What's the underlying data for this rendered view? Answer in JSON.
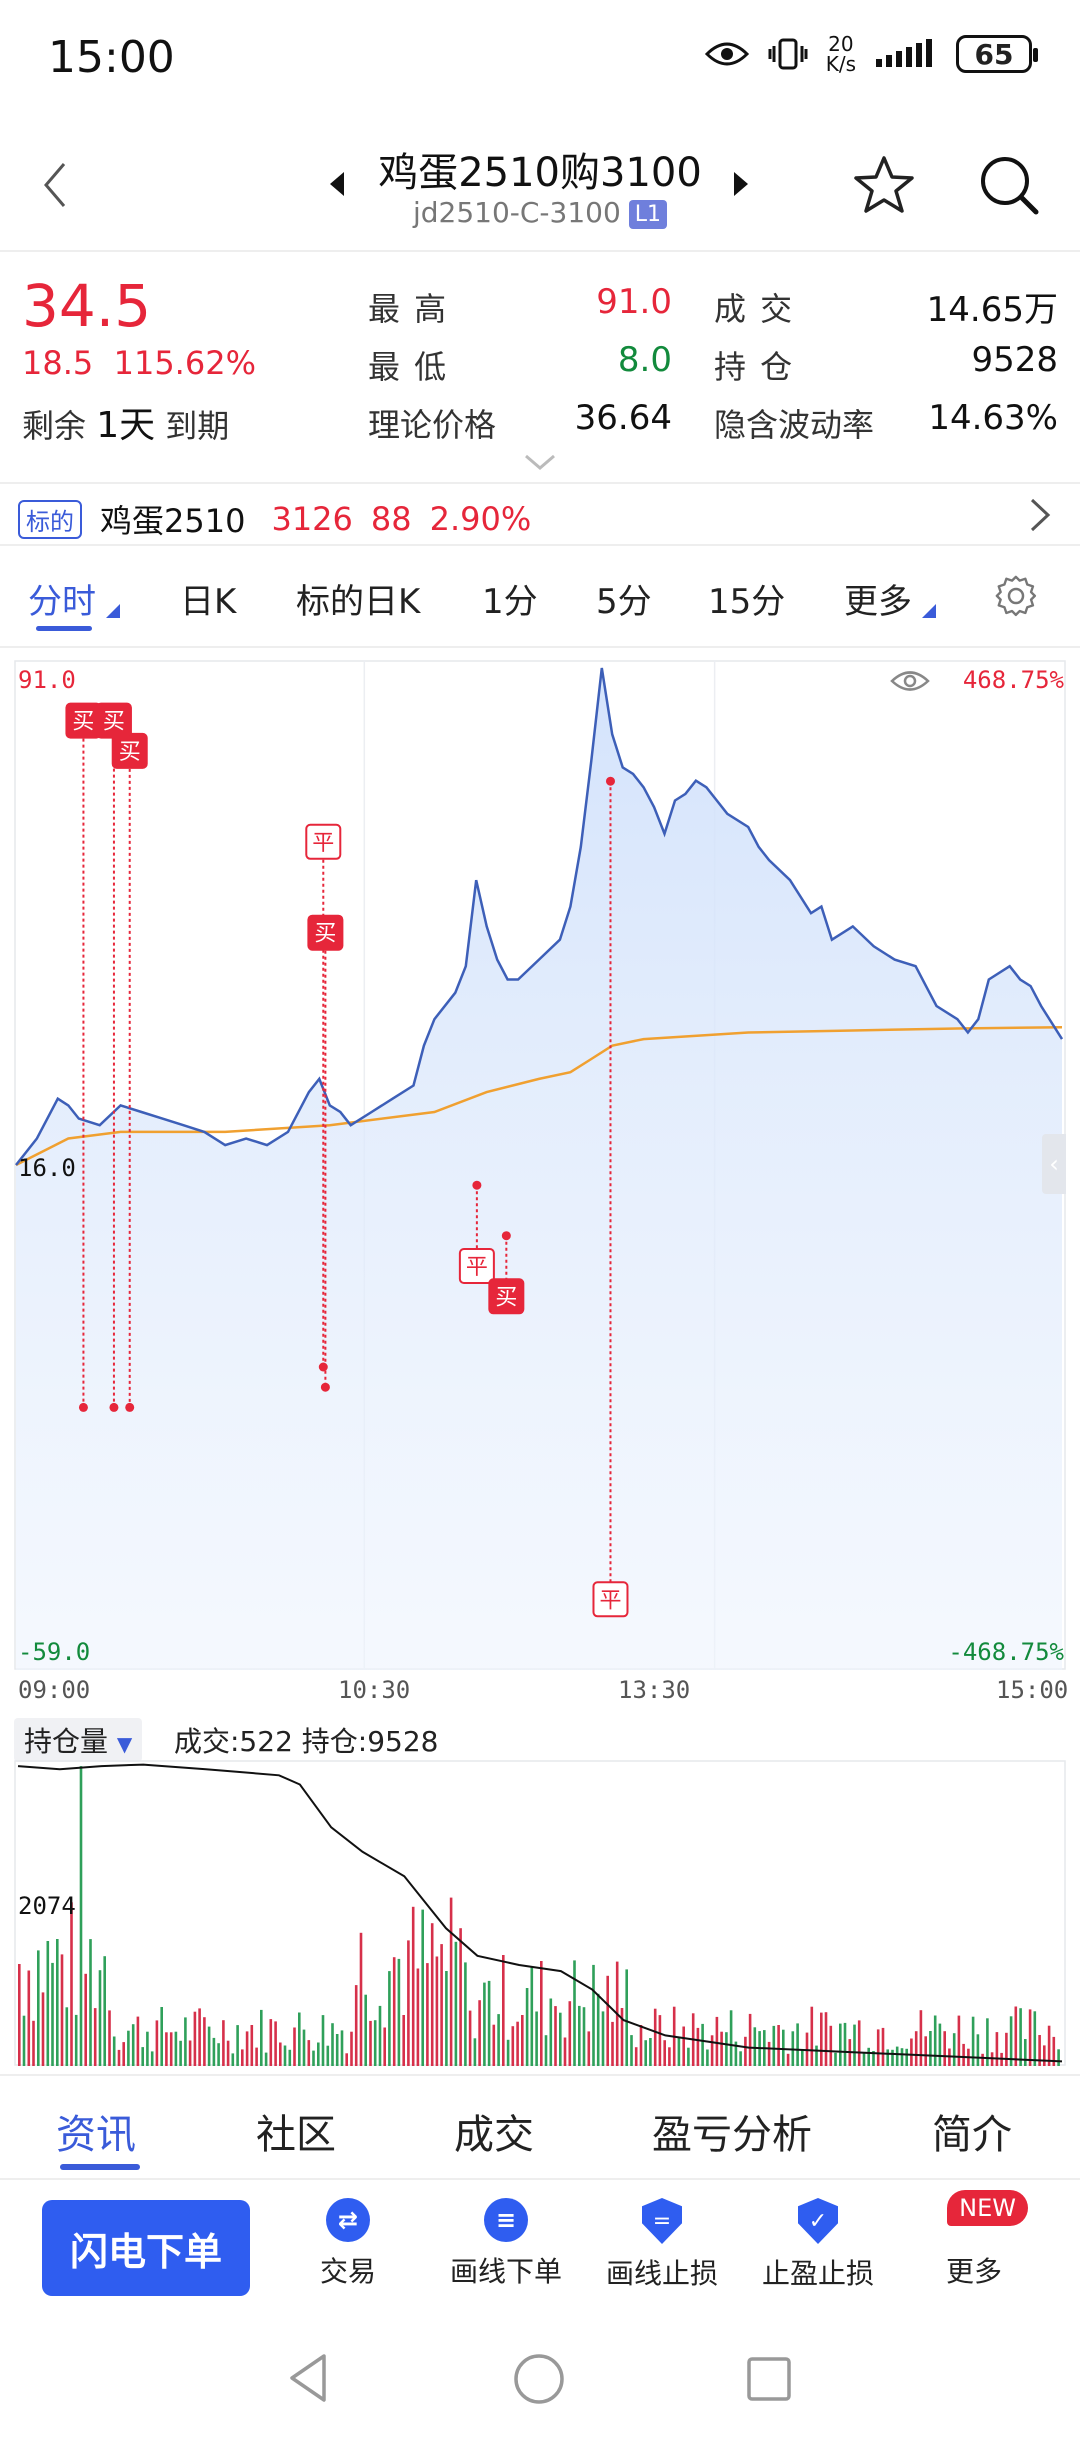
{
  "status": {
    "time": "15:00",
    "net_speed_top": "20",
    "net_speed_unit": "K/s",
    "battery": "65"
  },
  "header": {
    "title": "鸡蛋2510购3100",
    "code": "jd2510-C-3100",
    "level_badge": "L1"
  },
  "quote": {
    "price": "34.5",
    "change": "18.5",
    "change_pct": "115.62%",
    "remain_label": "剩余",
    "remain_value": "1天",
    "expire_label": "到期",
    "high_label": "最 高",
    "high_value": "91.0",
    "low_label": "最 低",
    "low_value": "8.0",
    "theory_label": "理论价格",
    "theory_value": "36.64",
    "volume_label": "成 交",
    "volume_value": "14.65万",
    "oi_label": "持 仓",
    "oi_value": "9528",
    "iv_label": "隐含波动率",
    "iv_value": "14.63%"
  },
  "underlying": {
    "tag": "标的",
    "name": "鸡蛋2510",
    "price": "3126",
    "change": "88",
    "change_pct": "2.90%"
  },
  "tabs": [
    "分时",
    "日K",
    "标的日K",
    "1分",
    "5分",
    "15分",
    "更多"
  ],
  "chart_labels": {
    "y_top": "91.0",
    "y_mid": "16.0",
    "y_bottom": "-59.0",
    "pct_top": "468.75%",
    "pct_bottom": "-468.75%",
    "time_ticks": [
      "09:00",
      "10:30",
      "13:30",
      "15:00"
    ],
    "vol_selector": "持仓量",
    "vol_info": "成交:522 持仓:9528",
    "vol_max": "2074",
    "markers": [
      {
        "text": "买"
      },
      {
        "text": "买"
      },
      {
        "text": "买"
      },
      {
        "text": "平"
      },
      {
        "text": "买"
      },
      {
        "text": "平"
      },
      {
        "text": "买"
      },
      {
        "text": "平"
      }
    ]
  },
  "chart_data": {
    "type": "line",
    "x_ticks": [
      "09:00",
      "10:30",
      "13:30",
      "15:00"
    ],
    "ylim": [
      -59.0,
      91.0
    ],
    "series": [],
    "price_points": [
      [
        0,
        16
      ],
      [
        0.02,
        20
      ],
      [
        0.04,
        26
      ],
      [
        0.05,
        25
      ],
      [
        0.06,
        23
      ],
      [
        0.08,
        22
      ],
      [
        0.1,
        25
      ],
      [
        0.12,
        24
      ],
      [
        0.14,
        23
      ],
      [
        0.16,
        22
      ],
      [
        0.18,
        21
      ],
      [
        0.2,
        19
      ],
      [
        0.22,
        20
      ],
      [
        0.24,
        19
      ],
      [
        0.26,
        21
      ],
      [
        0.28,
        27
      ],
      [
        0.29,
        29
      ],
      [
        0.3,
        25
      ],
      [
        0.31,
        24
      ],
      [
        0.32,
        22
      ],
      [
        0.34,
        24
      ],
      [
        0.36,
        26
      ],
      [
        0.38,
        28
      ],
      [
        0.39,
        34
      ],
      [
        0.4,
        38
      ],
      [
        0.42,
        42
      ],
      [
        0.43,
        46
      ],
      [
        0.44,
        59
      ],
      [
        0.45,
        52
      ],
      [
        0.46,
        47
      ],
      [
        0.47,
        44
      ],
      [
        0.48,
        44
      ],
      [
        0.5,
        47
      ],
      [
        0.52,
        50
      ],
      [
        0.53,
        55
      ],
      [
        0.54,
        64
      ],
      [
        0.55,
        77
      ],
      [
        0.56,
        91
      ],
      [
        0.57,
        81
      ],
      [
        0.58,
        76
      ],
      [
        0.59,
        75
      ],
      [
        0.6,
        73
      ],
      [
        0.61,
        70
      ],
      [
        0.62,
        66
      ],
      [
        0.63,
        71
      ],
      [
        0.64,
        72
      ],
      [
        0.65,
        74
      ],
      [
        0.66,
        73
      ],
      [
        0.67,
        71
      ],
      [
        0.68,
        69
      ],
      [
        0.7,
        67
      ],
      [
        0.71,
        64
      ],
      [
        0.72,
        62
      ],
      [
        0.74,
        59
      ],
      [
        0.76,
        54
      ],
      [
        0.77,
        55
      ],
      [
        0.78,
        50
      ],
      [
        0.8,
        52
      ],
      [
        0.82,
        49
      ],
      [
        0.84,
        47
      ],
      [
        0.86,
        46
      ],
      [
        0.87,
        43
      ],
      [
        0.88,
        40
      ],
      [
        0.9,
        38
      ],
      [
        0.91,
        36
      ],
      [
        0.92,
        38
      ],
      [
        0.93,
        44
      ],
      [
        0.95,
        46
      ],
      [
        0.96,
        44
      ],
      [
        0.97,
        43
      ],
      [
        0.98,
        40
      ],
      [
        1.0,
        35
      ]
    ],
    "avg_points": [
      [
        0,
        16
      ],
      [
        0.05,
        20
      ],
      [
        0.1,
        21
      ],
      [
        0.2,
        21
      ],
      [
        0.3,
        22
      ],
      [
        0.4,
        24
      ],
      [
        0.45,
        27
      ],
      [
        0.5,
        29
      ],
      [
        0.53,
        30
      ],
      [
        0.55,
        32
      ],
      [
        0.57,
        34
      ],
      [
        0.6,
        35
      ],
      [
        0.7,
        36
      ],
      [
        0.8,
        36.3
      ],
      [
        0.9,
        36.6
      ],
      [
        1.0,
        36.8
      ]
    ]
  },
  "bottom_tabs": [
    "资讯",
    "社区",
    "成交",
    "盈亏分析",
    "简介"
  ],
  "actions": {
    "flash_order": "闪电下单",
    "items": [
      "交易",
      "画线下单",
      "画线止损",
      "止盈止损",
      "更多"
    ],
    "new_badge": "NEW"
  },
  "colors": {
    "accent": "#3a5bd9",
    "up": "#e6263a",
    "down": "#128a3c",
    "price_line": "#3d5fb8",
    "avg_line": "#f0a030"
  }
}
